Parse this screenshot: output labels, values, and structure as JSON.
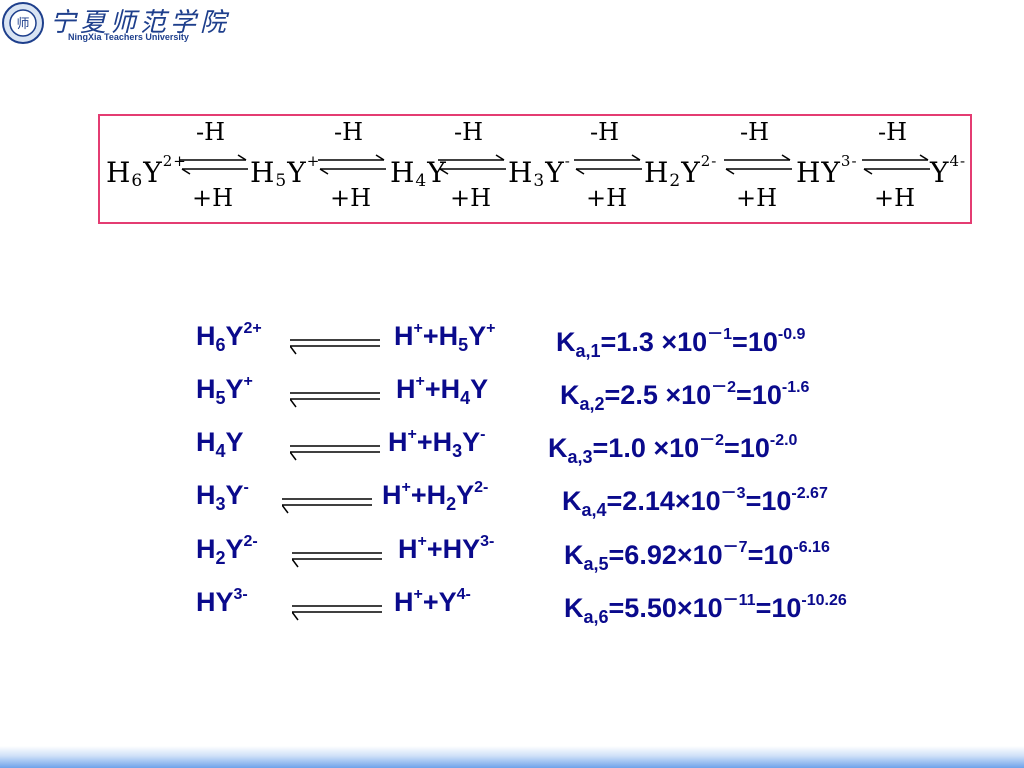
{
  "header": {
    "school_cn": "宁夏师范学院",
    "school_en": "NingXia Teachers University",
    "logo_text": "师"
  },
  "chain": {
    "species": [
      {
        "base": "H",
        "sub": "6",
        "mid": "Y",
        "sup": "2+"
      },
      {
        "base": "H",
        "sub": "5",
        "mid": "Y",
        "sup": "+"
      },
      {
        "base": "H",
        "sub": "4",
        "mid": "Y",
        "sup": ""
      },
      {
        "base": "H",
        "sub": "3",
        "mid": "Y",
        "sup": "-"
      },
      {
        "base": "H",
        "sub": "2",
        "mid": "Y",
        "sup": "2-"
      },
      {
        "base": "HY",
        "sub": "",
        "mid": "",
        "sup": "3-"
      },
      {
        "base": "Y",
        "sub": "",
        "mid": "",
        "sup": "4-"
      }
    ],
    "arrow_top": "-H",
    "arrow_bottom": "+H"
  },
  "equilibria": [
    {
      "lhs": {
        "h": "H",
        "hsub": "6",
        "y": "Y",
        "ysup": "2+"
      },
      "rhs": {
        "hp": "H",
        "hpsup": "+",
        "plus": "+",
        "h": "H",
        "hsub": "5",
        "y": "Y",
        "ysup": "+"
      },
      "k": {
        "label": "K",
        "sub": "a,1",
        "eq": "=1.3 ×10",
        "exp": "－1",
        "eq2": "=10",
        "exp2": "-0.9"
      }
    },
    {
      "lhs": {
        "h": "H",
        "hsub": "5",
        "y": "Y",
        "ysup": "+"
      },
      "rhs": {
        "hp": "H",
        "hpsup": "+",
        "plus": "+",
        "h": "H",
        "hsub": "4",
        "y": "Y",
        "ysup": ""
      },
      "k": {
        "label": "K",
        "sub": "a,2",
        "eq": "=2.5 ×10",
        "exp": "－2",
        "eq2": "=10",
        "exp2": "-1.6"
      }
    },
    {
      "lhs": {
        "h": "H",
        "hsub": "4",
        "y": "Y",
        "ysup": ""
      },
      "rhs": {
        "hp": "H",
        "hpsup": "+",
        "plus": "+",
        "h": "H",
        "hsub": "3",
        "y": "Y",
        "ysup": "-"
      },
      "k": {
        "label": "K",
        "sub": "a,3",
        "eq": "=1.0 ×10",
        "exp": "－2",
        "eq2": "=10",
        "exp2": "-2.0"
      }
    },
    {
      "lhs": {
        "h": "H",
        "hsub": "3",
        "y": "Y",
        "ysup": "-"
      },
      "rhs": {
        "hp": "H",
        "hpsup": "+",
        "plus": "+",
        "h": "H",
        "hsub": "2",
        "y": "Y",
        "ysup": "2-"
      },
      "k": {
        "label": "K",
        "sub": "a,4",
        "eq": "=2.14×10",
        "exp": "－3",
        "eq2": "=10",
        "exp2": "-2.67"
      }
    },
    {
      "lhs": {
        "h": "H",
        "hsub": "2",
        "y": "Y",
        "ysup": "2-"
      },
      "rhs": {
        "hp": "H",
        "hpsup": "+",
        "plus": "+",
        "h": "HY",
        "hsub": "",
        "y": "",
        "ysup": "3-"
      },
      "k": {
        "label": "K",
        "sub": "a,5",
        "eq": "=6.92×10",
        "exp": "－7",
        "eq2": "=10",
        "exp2": "-6.16"
      }
    },
    {
      "lhs": {
        "h": "HY",
        "hsub": "",
        "y": "",
        "ysup": "3-"
      },
      "rhs": {
        "hp": "H",
        "hpsup": "+",
        "plus": "+",
        "h": "Y",
        "hsub": "",
        "y": "",
        "ysup": "4-"
      },
      "k": {
        "label": "K",
        "sub": "a,6",
        "eq": "=5.50×10",
        "exp": "－11",
        "eq2": "=10",
        "exp2": "-10.26"
      }
    }
  ],
  "colors": {
    "equation_text": "#0a0a8c",
    "box_border": "#e43c72",
    "school_blue": "#1e3f8c"
  }
}
